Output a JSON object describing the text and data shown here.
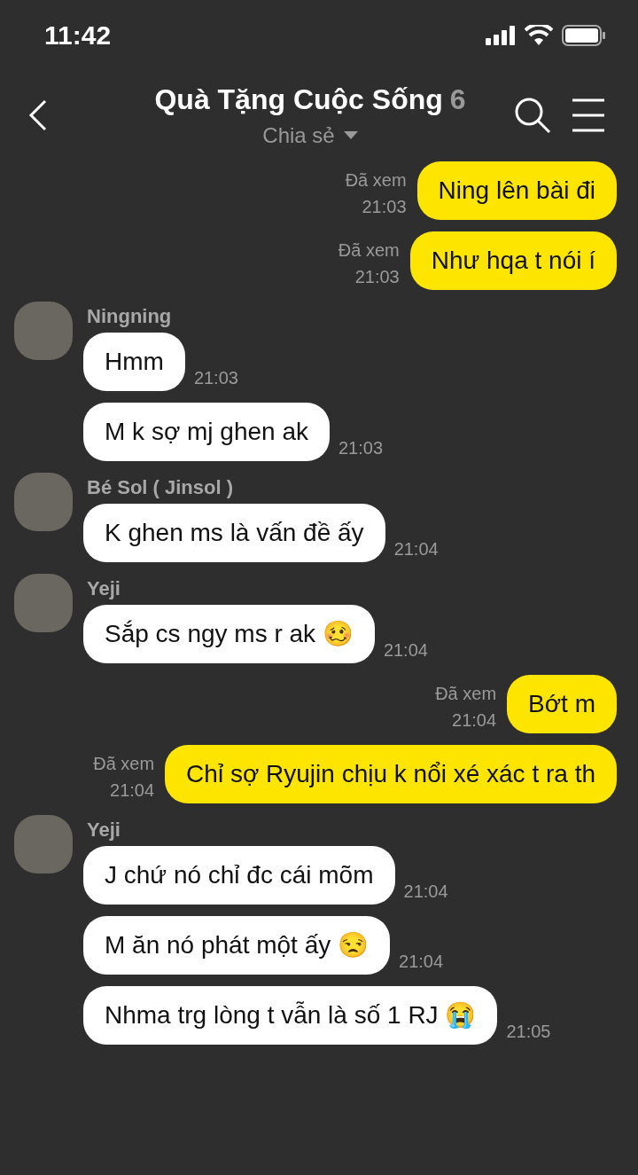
{
  "status_bar": {
    "time": "11:42"
  },
  "header": {
    "title": "Quà Tặng Cuộc Sống",
    "member_count": "6",
    "subtitle": "Chia sẻ"
  },
  "messages": [
    {
      "kind": "sent",
      "read_label": "Đã xem",
      "time": "21:03",
      "text": "Ning lên bài đi"
    },
    {
      "kind": "sent",
      "read_label": "Đã xem",
      "time": "21:03",
      "text": "Như hqa t nói í"
    },
    {
      "kind": "received",
      "sender": "Ningning",
      "bubbles": [
        {
          "text": "Hmm",
          "time": "21:03"
        },
        {
          "text": "M k sợ mj ghen ak",
          "time": "21:03"
        }
      ]
    },
    {
      "kind": "received",
      "sender": "Bé Sol ( Jinsol )",
      "bubbles": [
        {
          "text": "K ghen ms là vấn đề ấy",
          "time": "21:04"
        }
      ]
    },
    {
      "kind": "received",
      "sender": "Yeji",
      "bubbles": [
        {
          "text": "Sắp cs ngy ms r ak 🥴",
          "time": "21:04"
        }
      ]
    },
    {
      "kind": "sent",
      "read_label": "Đã xem",
      "time": "21:04",
      "text": "Bớt m"
    },
    {
      "kind": "sent",
      "read_label": "Đã xem",
      "time": "21:04",
      "text": "Chỉ sợ Ryujin chịu k nổi xé xác t ra th"
    },
    {
      "kind": "received",
      "sender": "Yeji",
      "bubbles": [
        {
          "text": "J chứ nó chỉ đc cái mõm",
          "time": "21:04"
        },
        {
          "text": "M ăn nó phát một ấy 😒",
          "time": "21:04"
        },
        {
          "text": "Nhma trg lòng t vẫn là số 1 RJ 😭",
          "time": "21:05"
        }
      ]
    }
  ]
}
